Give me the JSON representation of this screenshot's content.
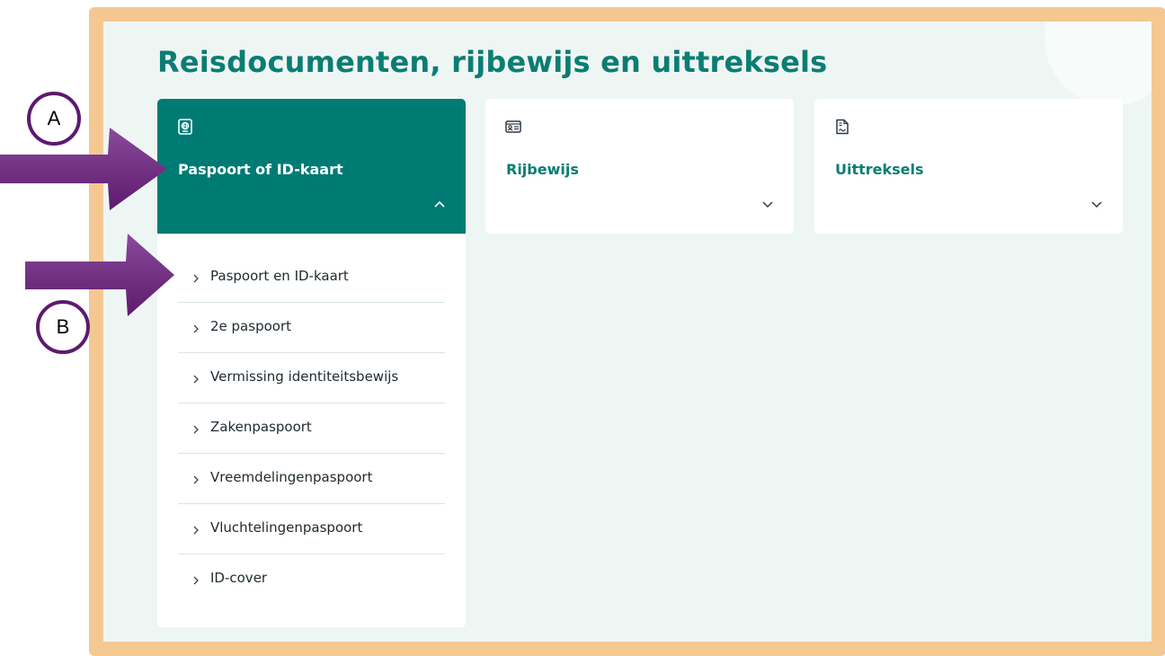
{
  "page": {
    "title": "Reisdocumenten, rijbewijs en uittreksels"
  },
  "cards": [
    {
      "label": "Paspoort of ID-kaart",
      "icon": "passport-icon",
      "state": "expanded"
    },
    {
      "label": "Rijbewijs",
      "icon": "id-card-icon",
      "state": "collapsed"
    },
    {
      "label": "Uittreksels",
      "icon": "document-icon",
      "state": "collapsed"
    }
  ],
  "submenu": {
    "items": [
      {
        "label": "Paspoort en ID-kaart"
      },
      {
        "label": "2e paspoort"
      },
      {
        "label": "Vermissing identiteitsbewijs"
      },
      {
        "label": "Zakenpaspoort"
      },
      {
        "label": "Vreemdelingenpaspoort"
      },
      {
        "label": "Vluchtelingenpaspoort"
      },
      {
        "label": "ID-cover"
      }
    ]
  },
  "annotations": {
    "marker_a": "A",
    "marker_b": "B"
  },
  "colors": {
    "brand_teal": "#007b73",
    "title_teal": "#0b7d73",
    "panel_bg": "#eef6f4",
    "frame_border": "#f5c892",
    "annotation_purple": "#6b2a7a"
  }
}
